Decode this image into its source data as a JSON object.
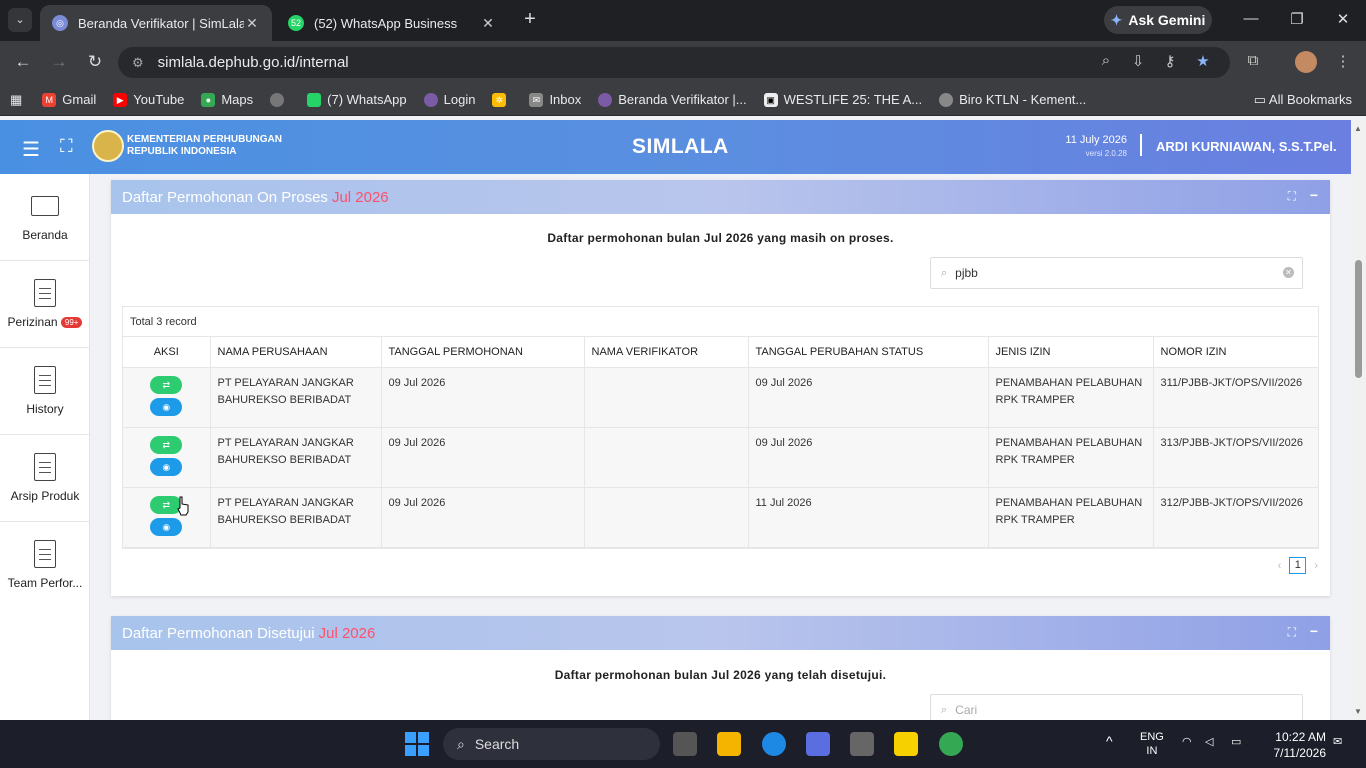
{
  "browser": {
    "tabs": [
      {
        "title": "Beranda Verifikator | SimLala",
        "active": true
      },
      {
        "title": "(52) WhatsApp Business",
        "active": false
      }
    ],
    "gemini_label": "Ask Gemini",
    "url": "simlala.dephub.go.id/internal",
    "bookmarks": [
      "Gmail",
      "YouTube",
      "Maps",
      "",
      "(7) WhatsApp",
      "Login",
      "",
      "Inbox",
      "Beranda Verifikator |...",
      "WESTLIFE 25: THE A...",
      "Biro KTLN - Kement..."
    ],
    "all_bookmarks": "All Bookmarks",
    "wa_badge": "52"
  },
  "header": {
    "ministry_line1": "KEMENTERIAN PERHUBUNGAN",
    "ministry_line2": "REPUBLIK INDONESIA",
    "app_title": "SIMLALA",
    "date": "11 July 2026",
    "version": "versi 2.0.28",
    "user": "ARDI KURNIAWAN, S.S.T.Pel."
  },
  "sidebar": {
    "items": [
      {
        "label": "Beranda"
      },
      {
        "label": "Perizinan",
        "badge": "99+"
      },
      {
        "label": "History"
      },
      {
        "label": "Arsip Produk"
      },
      {
        "label": "Team Perfor..."
      }
    ]
  },
  "panel1": {
    "title": "Daftar Permohonan On Proses",
    "title_month": "Jul 2026",
    "subtitle": "Daftar permohonan bulan Jul 2026 yang masih on proses.",
    "search_value": "pjbb",
    "total": "Total 3 record",
    "columns": [
      "AKSI",
      "NAMA PERUSAHAAN",
      "TANGGAL PERMOHONAN",
      "NAMA VERIFIKATOR",
      "TANGGAL PERUBAHAN STATUS",
      "JENIS IZIN",
      "NOMOR IZIN"
    ],
    "rows": [
      {
        "company": "PT PELAYARAN JANGKAR BAHUREKSO BERIBADAT",
        "tgl_permohonan": "09 Jul 2026",
        "verifikator": "",
        "tgl_status": "09 Jul 2026",
        "jenis": "PENAMBAHAN PELABUHAN RPK TRAMPER",
        "nomor": "311/PJBB-JKT/OPS/VII/2026"
      },
      {
        "company": "PT PELAYARAN JANGKAR BAHUREKSO BERIBADAT",
        "tgl_permohonan": "09 Jul 2026",
        "verifikator": "",
        "tgl_status": "09 Jul 2026",
        "jenis": "PENAMBAHAN PELABUHAN RPK TRAMPER",
        "nomor": "313/PJBB-JKT/OPS/VII/2026"
      },
      {
        "company": "PT PELAYARAN JANGKAR BAHUREKSO BERIBADAT",
        "tgl_permohonan": "09 Jul 2026",
        "verifikator": "",
        "tgl_status": "11 Jul 2026",
        "jenis": "PENAMBAHAN PELABUHAN RPK TRAMPER",
        "nomor": "312/PJBB-JKT/OPS/VII/2026"
      }
    ],
    "page": "1"
  },
  "panel2": {
    "title": "Daftar Permohonan Disetujui",
    "title_month": "Jul 2026",
    "subtitle": "Daftar permohonan bulan Jul 2026 yang telah disetujui.",
    "search_placeholder": "Cari"
  },
  "taskbar": {
    "search_label": "Search",
    "lang1": "ENG",
    "lang2": "IN",
    "time": "10:22 AM",
    "date": "7/11/2026"
  }
}
